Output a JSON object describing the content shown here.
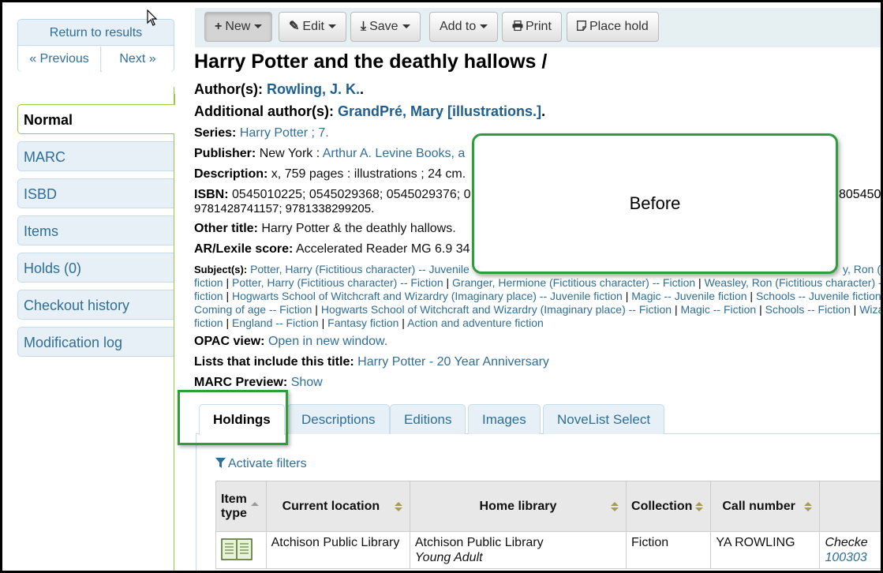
{
  "sidebar": {
    "return_label": "Return to results",
    "previous_label": "« Previous",
    "next_label": "Next »",
    "menu": [
      {
        "label": "Normal"
      },
      {
        "label": "MARC"
      },
      {
        "label": "ISBD"
      },
      {
        "label": "Items"
      },
      {
        "label": "Holds (0)"
      },
      {
        "label": "Checkout history"
      },
      {
        "label": "Modification log"
      }
    ]
  },
  "toolbar": {
    "new": "New",
    "edit": "Edit",
    "save": "Save",
    "add_to": "Add to",
    "print": "Print",
    "place_hold": "Place hold"
  },
  "record": {
    "title": "Harry Potter and the deathly hallows /",
    "authors_label": "Author(s):",
    "authors": "Rowling, J. K.",
    "additional_label": "Additional author(s):",
    "additional": "GrandPré, Mary [illustrations.]",
    "series_label": "Series:",
    "series": "Harry Potter ; 7.",
    "publisher_label": "Publisher:",
    "publisher_place": "New York : ",
    "publisher_name": "Arthur A. Levine Books, a",
    "description_label": "Description:",
    "description": "x, 759 pages : illustrations ; 24 cm.",
    "isbn_label": "ISBN:",
    "isbn_line1": "0545010225; 0545029368; 0545029376; 0",
    "isbn_line1_right": "805450",
    "isbn_line2": "9781428741157; 9781338299205.",
    "other_title_label": "Other title:",
    "other_title": "Harry Potter & the deathly hallows.",
    "ar_label": "AR/Lexile score:",
    "ar_value": "Accelerated Reader MG 6.9 34",
    "subjects_label": "Subject(s):",
    "subject_lines": [
      [
        "Potter, Harry (Fictitious character) -- Juvenile"
      ],
      [
        "fiction",
        "Potter, Harry (Fictitious character) -- Fiction",
        "Granger, Hermione (Fictitious character) -- Fiction",
        "Weasley, Ron (Fictitious character) --"
      ],
      [
        "fiction",
        "Hogwarts School of Witchcraft and Wizardry (Imaginary place) -- Juvenile fiction",
        "Magic -- Juvenile fiction",
        "Schools -- Juvenile fiction"
      ],
      [
        "Coming of age -- Fiction",
        "Hogwarts School of Witchcraft and Wizardry (Imaginary place) -- Fiction",
        "Magic -- Fiction",
        "Schools -- Fiction",
        "Wizar"
      ],
      [
        "fiction",
        "England -- Fiction",
        "Fantasy fiction",
        "Action and adventure fiction"
      ]
    ],
    "subject_line1_right": "y, Ron (F",
    "opac_label": "OPAC view:",
    "opac_link": "Open in new window.",
    "lists_label": "Lists that include this title:",
    "lists_link": "Harry Potter - 20 Year Anniversary",
    "marc_label": "MARC Preview:",
    "marc_link": "Show"
  },
  "overlay": {
    "before_text": "Before"
  },
  "tabs": [
    {
      "label": "Holdings"
    },
    {
      "label": "Descriptions"
    },
    {
      "label": "Editions"
    },
    {
      "label": "Images"
    },
    {
      "label": "NoveList Select"
    }
  ],
  "holdings": {
    "filters_label": "Activate filters",
    "columns": [
      "Item type",
      "Current location",
      "Home library",
      "Collection",
      "Call number"
    ],
    "rows": [
      {
        "current_location": "Atchison Public Library",
        "home_library": "Atchison Public Library",
        "home_library_sub": "Young Adult",
        "collection": "Fiction",
        "call_number": "YA ROWLING",
        "status": "Checke",
        "status_link": "100303"
      }
    ]
  },
  "colors": {
    "accent_green": "#2e9e3a",
    "link_blue": "#2f6e97",
    "nav_bg": "#e6f0f6"
  }
}
